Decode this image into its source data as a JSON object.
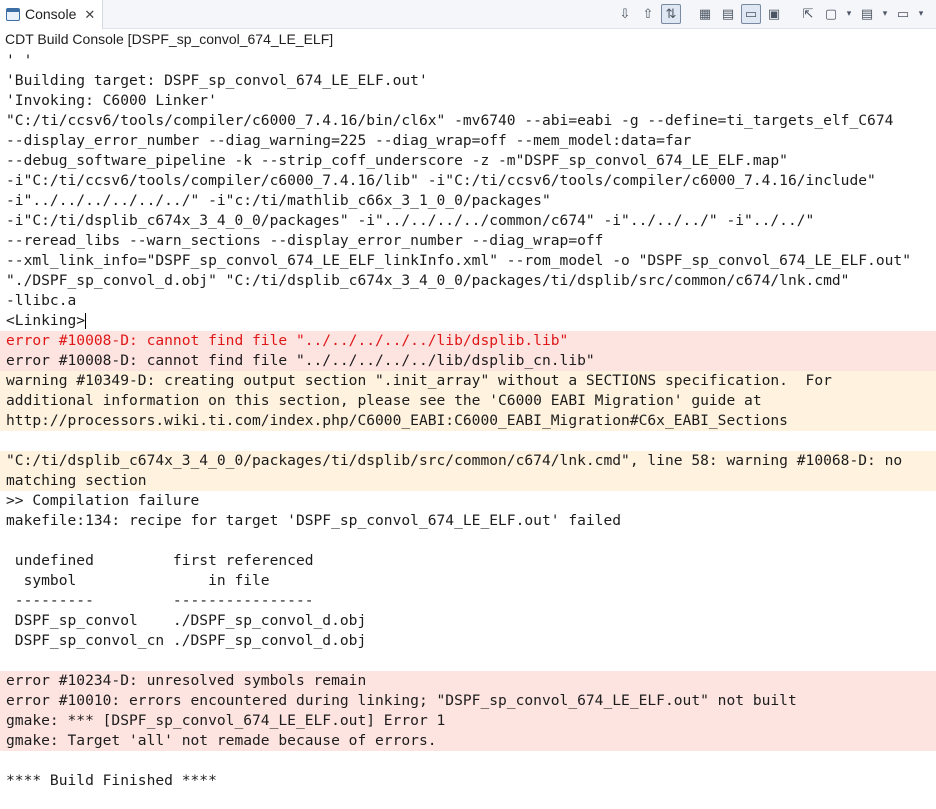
{
  "tab": {
    "label": "Console",
    "close": "✕"
  },
  "toolbar": {
    "buttons": [
      "⇩",
      "⇧",
      "⇅",
      "▦",
      "▤",
      "▭",
      "▣",
      "⇱",
      "▢",
      "▾",
      "▤",
      "▾",
      "▭",
      "▾"
    ]
  },
  "console_title": "CDT Build Console [DSPF_sp_convol_674_LE_ELF]",
  "lines": [
    {
      "text": "' '",
      "kind": "normal"
    },
    {
      "text": "'Building target: DSPF_sp_convol_674_LE_ELF.out'",
      "kind": "normal"
    },
    {
      "text": "'Invoking: C6000 Linker'",
      "kind": "normal"
    },
    {
      "text": "\"C:/ti/ccsv6/tools/compiler/c6000_7.4.16/bin/cl6x\" -mv6740 --abi=eabi -g --define=ti_targets_elf_C674",
      "kind": "normal"
    },
    {
      "text": "--display_error_number --diag_warning=225 --diag_wrap=off --mem_model:data=far",
      "kind": "normal"
    },
    {
      "text": "--debug_software_pipeline -k --strip_coff_underscore -z -m\"DSPF_sp_convol_674_LE_ELF.map\"",
      "kind": "normal"
    },
    {
      "text": "-i\"C:/ti/ccsv6/tools/compiler/c6000_7.4.16/lib\" -i\"C:/ti/ccsv6/tools/compiler/c6000_7.4.16/include\"",
      "kind": "normal"
    },
    {
      "text": "-i\"../../../../../../\" -i\"c:/ti/mathlib_c66x_3_1_0_0/packages\"",
      "kind": "normal"
    },
    {
      "text": "-i\"C:/ti/dsplib_c674x_3_4_0_0/packages\" -i\"../../../../common/c674\" -i\"../../../\" -i\"../../\"",
      "kind": "normal"
    },
    {
      "text": "--reread_libs --warn_sections --display_error_number --diag_wrap=off",
      "kind": "normal"
    },
    {
      "text": "--xml_link_info=\"DSPF_sp_convol_674_LE_ELF_linkInfo.xml\" --rom_model -o \"DSPF_sp_convol_674_LE_ELF.out\"",
      "kind": "normal"
    },
    {
      "text": "\"./DSPF_sp_convol_d.obj\" \"C:/ti/dsplib_c674x_3_4_0_0/packages/ti/dsplib/src/common/c674/lnk.cmd\"",
      "kind": "normal"
    },
    {
      "text": "-llibc.a",
      "kind": "normal"
    },
    {
      "text": "<Linking>",
      "kind": "normal",
      "caret": true
    },
    {
      "text": "error #10008-D: cannot find file \"../../../../../lib/dsplib.lib\"",
      "kind": "error"
    },
    {
      "text": "error #10008-D: cannot find file \"../../../../../lib/dsplib_cn.lib\"",
      "kind": "errordark"
    },
    {
      "text": "warning #10349-D: creating output section \".init_array\" without a SECTIONS specification.  For",
      "kind": "warning"
    },
    {
      "text": "additional information on this section, please see the 'C6000 EABI Migration' guide at",
      "kind": "warning"
    },
    {
      "text": "http://processors.wiki.ti.com/index.php/C6000_EABI:C6000_EABI_Migration#C6x_EABI_Sections",
      "kind": "warning"
    },
    {
      "text": "",
      "kind": "normal"
    },
    {
      "text": "\"C:/ti/dsplib_c674x_3_4_0_0/packages/ti/dsplib/src/common/c674/lnk.cmd\", line 58: warning #10068-D: no",
      "kind": "warning"
    },
    {
      "text": "matching section",
      "kind": "warning"
    },
    {
      "text": ">> Compilation failure",
      "kind": "normal"
    },
    {
      "text": "makefile:134: recipe for target 'DSPF_sp_convol_674_LE_ELF.out' failed",
      "kind": "normal"
    },
    {
      "text": "",
      "kind": "normal"
    },
    {
      "text": " undefined         first referenced",
      "kind": "normal"
    },
    {
      "text": "  symbol               in file",
      "kind": "normal"
    },
    {
      "text": " ---------         ----------------",
      "kind": "normal"
    },
    {
      "text": " DSPF_sp_convol    ./DSPF_sp_convol_d.obj",
      "kind": "normal"
    },
    {
      "text": " DSPF_sp_convol_cn ./DSPF_sp_convol_d.obj",
      "kind": "normal"
    },
    {
      "text": "",
      "kind": "normal"
    },
    {
      "text": "error #10234-D: unresolved symbols remain",
      "kind": "errordark"
    },
    {
      "text": "error #10010: errors encountered during linking; \"DSPF_sp_convol_674_LE_ELF.out\" not built",
      "kind": "errordark"
    },
    {
      "text": "gmake: *** [DSPF_sp_convol_674_LE_ELF.out] Error 1",
      "kind": "errordark"
    },
    {
      "text": "gmake: Target 'all' not remade because of errors.",
      "kind": "errordark"
    },
    {
      "text": "",
      "kind": "normal"
    },
    {
      "text": "**** Build Finished ****",
      "kind": "normal"
    }
  ]
}
